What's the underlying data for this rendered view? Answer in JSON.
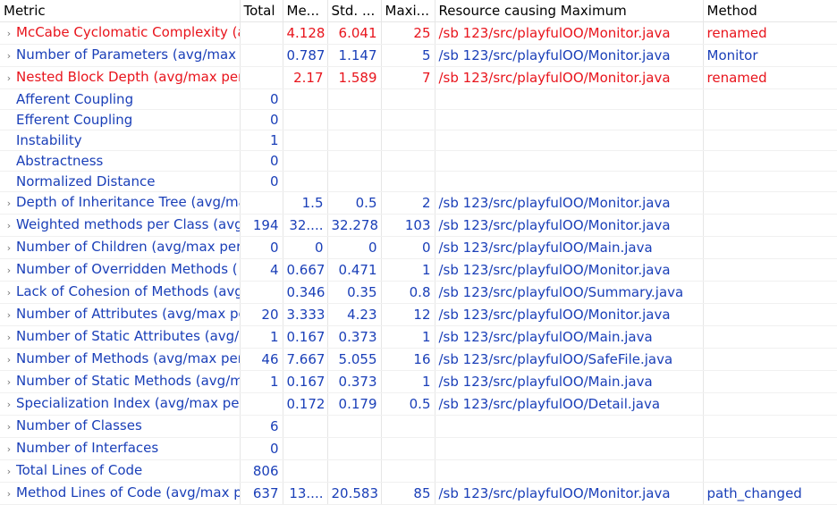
{
  "headers": [
    "Metric",
    "Total",
    "Me...",
    "Std. ...",
    "Maxi...",
    "Resource causing Maximum",
    "Method"
  ],
  "rows": [
    {
      "expand": true,
      "color": "red",
      "metric": "McCabe Cyclomatic Complexity (a",
      "total": "",
      "mean": "4.128",
      "std": "6.041",
      "max": "25",
      "resource": "/sb 123/src/playfulOO/Monitor.java",
      "method": "renamed"
    },
    {
      "expand": true,
      "color": "blue",
      "metric": "Number of Parameters (avg/max p",
      "total": "",
      "mean": "0.787",
      "std": "1.147",
      "max": "5",
      "resource": "/sb 123/src/playfulOO/Monitor.java",
      "method": "Monitor"
    },
    {
      "expand": true,
      "color": "red",
      "metric": "Nested Block Depth (avg/max per",
      "total": "",
      "mean": "2.17",
      "std": "1.589",
      "max": "7",
      "resource": "/sb 123/src/playfulOO/Monitor.java",
      "method": "renamed"
    },
    {
      "expand": false,
      "color": "blue",
      "metric": "Afferent Coupling",
      "total": "0",
      "mean": "",
      "std": "",
      "max": "",
      "resource": "",
      "method": ""
    },
    {
      "expand": false,
      "color": "blue",
      "metric": "Efferent Coupling",
      "total": "0",
      "mean": "",
      "std": "",
      "max": "",
      "resource": "",
      "method": ""
    },
    {
      "expand": false,
      "color": "blue",
      "metric": "Instability",
      "total": "1",
      "mean": "",
      "std": "",
      "max": "",
      "resource": "",
      "method": ""
    },
    {
      "expand": false,
      "color": "blue",
      "metric": "Abstractness",
      "total": "0",
      "mean": "",
      "std": "",
      "max": "",
      "resource": "",
      "method": ""
    },
    {
      "expand": false,
      "color": "blue",
      "metric": "Normalized Distance",
      "total": "0",
      "mean": "",
      "std": "",
      "max": "",
      "resource": "",
      "method": ""
    },
    {
      "expand": true,
      "color": "blue",
      "metric": "Depth of Inheritance Tree (avg/ma",
      "total": "",
      "mean": "1.5",
      "std": "0.5",
      "max": "2",
      "resource": "/sb 123/src/playfulOO/Monitor.java",
      "method": ""
    },
    {
      "expand": true,
      "color": "blue",
      "metric": "Weighted methods per Class (avg",
      "total": "194",
      "mean": "32....",
      "std": "32.278",
      "max": "103",
      "resource": "/sb 123/src/playfulOO/Monitor.java",
      "method": ""
    },
    {
      "expand": true,
      "color": "blue",
      "metric": "Number of Children (avg/max per",
      "total": "0",
      "mean": "0",
      "std": "0",
      "max": "0",
      "resource": "/sb 123/src/playfulOO/Main.java",
      "method": ""
    },
    {
      "expand": true,
      "color": "blue",
      "metric": "Number of Overridden Methods (",
      "total": "4",
      "mean": "0.667",
      "std": "0.471",
      "max": "1",
      "resource": "/sb 123/src/playfulOO/Monitor.java",
      "method": ""
    },
    {
      "expand": true,
      "color": "blue",
      "metric": "Lack of Cohesion of Methods (avg",
      "total": "",
      "mean": "0.346",
      "std": "0.35",
      "max": "0.8",
      "resource": "/sb 123/src/playfulOO/Summary.java",
      "method": ""
    },
    {
      "expand": true,
      "color": "blue",
      "metric": "Number of Attributes (avg/max pe",
      "total": "20",
      "mean": "3.333",
      "std": "4.23",
      "max": "12",
      "resource": "/sb 123/src/playfulOO/Monitor.java",
      "method": ""
    },
    {
      "expand": true,
      "color": "blue",
      "metric": "Number of Static Attributes (avg/",
      "total": "1",
      "mean": "0.167",
      "std": "0.373",
      "max": "1",
      "resource": "/sb 123/src/playfulOO/Main.java",
      "method": ""
    },
    {
      "expand": true,
      "color": "blue",
      "metric": "Number of Methods (avg/max per",
      "total": "46",
      "mean": "7.667",
      "std": "5.055",
      "max": "16",
      "resource": "/sb 123/src/playfulOO/SafeFile.java",
      "method": ""
    },
    {
      "expand": true,
      "color": "blue",
      "metric": "Number of Static Methods (avg/m",
      "total": "1",
      "mean": "0.167",
      "std": "0.373",
      "max": "1",
      "resource": "/sb 123/src/playfulOO/Main.java",
      "method": ""
    },
    {
      "expand": true,
      "color": "blue",
      "metric": "Specialization Index (avg/max per",
      "total": "",
      "mean": "0.172",
      "std": "0.179",
      "max": "0.5",
      "resource": "/sb 123/src/playfulOO/Detail.java",
      "method": ""
    },
    {
      "expand": true,
      "color": "blue",
      "metric": "Number of Classes",
      "total": "6",
      "mean": "",
      "std": "",
      "max": "",
      "resource": "",
      "method": ""
    },
    {
      "expand": true,
      "color": "blue",
      "metric": "Number of Interfaces",
      "total": "0",
      "mean": "",
      "std": "",
      "max": "",
      "resource": "",
      "method": ""
    },
    {
      "expand": true,
      "color": "blue",
      "metric": "Total Lines of Code",
      "total": "806",
      "mean": "",
      "std": "",
      "max": "",
      "resource": "",
      "method": ""
    },
    {
      "expand": true,
      "color": "blue",
      "metric": "Method Lines of Code (avg/max p",
      "total": "637",
      "mean": "13....",
      "std": "20.583",
      "max": "85",
      "resource": "/sb 123/src/playfulOO/Monitor.java",
      "method": "path_changed"
    }
  ],
  "icons": {
    "expand": "chevron-right-icon"
  },
  "colors": {
    "red": "#e8141c",
    "blue": "#1a3fb8"
  }
}
